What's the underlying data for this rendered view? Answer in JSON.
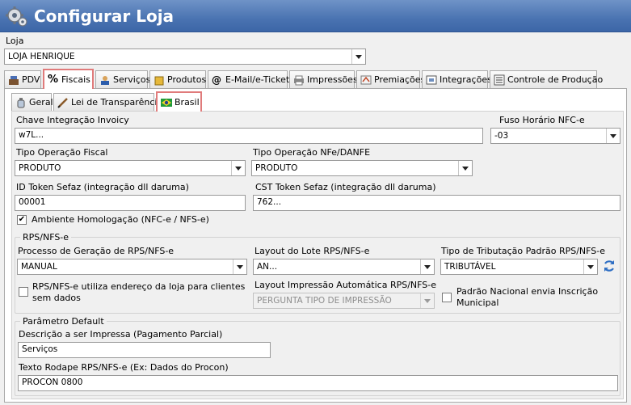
{
  "window": {
    "title": "Configurar Loja"
  },
  "store": {
    "label": "Loja",
    "value": "LOJA HENRIQUE"
  },
  "main_tabs": [
    "PDV",
    "Fiscais",
    "Serviços",
    "Produtos",
    "E-Mail/e-Ticket",
    "Impressões",
    "Premiações",
    "Integrações",
    "Controle de Produção"
  ],
  "sub_tabs": [
    "Geral",
    "Lei de Transparência",
    "Brasil"
  ],
  "form": {
    "invoicy_key": {
      "label": "Chave Integração Invoicy",
      "value": "w7L..."
    },
    "timezone": {
      "label": "Fuso Horário NFC-e",
      "value": "-03"
    },
    "fiscal_op": {
      "label": "Tipo Operação Fiscal",
      "value": "PRODUTO"
    },
    "nfe_op": {
      "label": "Tipo Operação NFe/DANFE",
      "value": "PRODUTO"
    },
    "token_id": {
      "label": "ID Token Sefaz (integração dll daruma)",
      "value": "00001"
    },
    "token_cst": {
      "label": "CST Token Sefaz (integração dll daruma)",
      "value": "762..."
    },
    "homolog": {
      "label": "Ambiente Homologação (NFC-e / NFS-e)",
      "mark": "✔"
    }
  },
  "rps": {
    "legend": "RPS/NFS-e",
    "process": {
      "label": "Processo de Geração de RPS/NFS-e",
      "value": "MANUAL"
    },
    "layout": {
      "label": "Layout do Lote RPS/NFS-e",
      "value": "AN..."
    },
    "tax_type": {
      "label": "Tipo de Tributação Padrão RPS/NFS-e",
      "value": "TRIBUTÁVEL"
    },
    "use_address": {
      "label": "RPS/NFS-e utiliza endereço da loja para clientes sem dados"
    },
    "print_layout": {
      "label": "Layout Impressão Automática RPS/NFS-e",
      "value": "PERGUNTA TIPO DE IMPRESSÃO"
    },
    "national": {
      "label": "Padrão Nacional envia Inscrição Municipal"
    }
  },
  "defaults": {
    "legend": "Parâmetro Default",
    "description": {
      "label": "Descrição a ser Impressa (Pagamento Parcial)",
      "value": "Serviços"
    },
    "footer": {
      "label": "Texto Rodape RPS/NFS-e (Ex: Dados do Procon)",
      "value": "PROCON 0800"
    }
  }
}
